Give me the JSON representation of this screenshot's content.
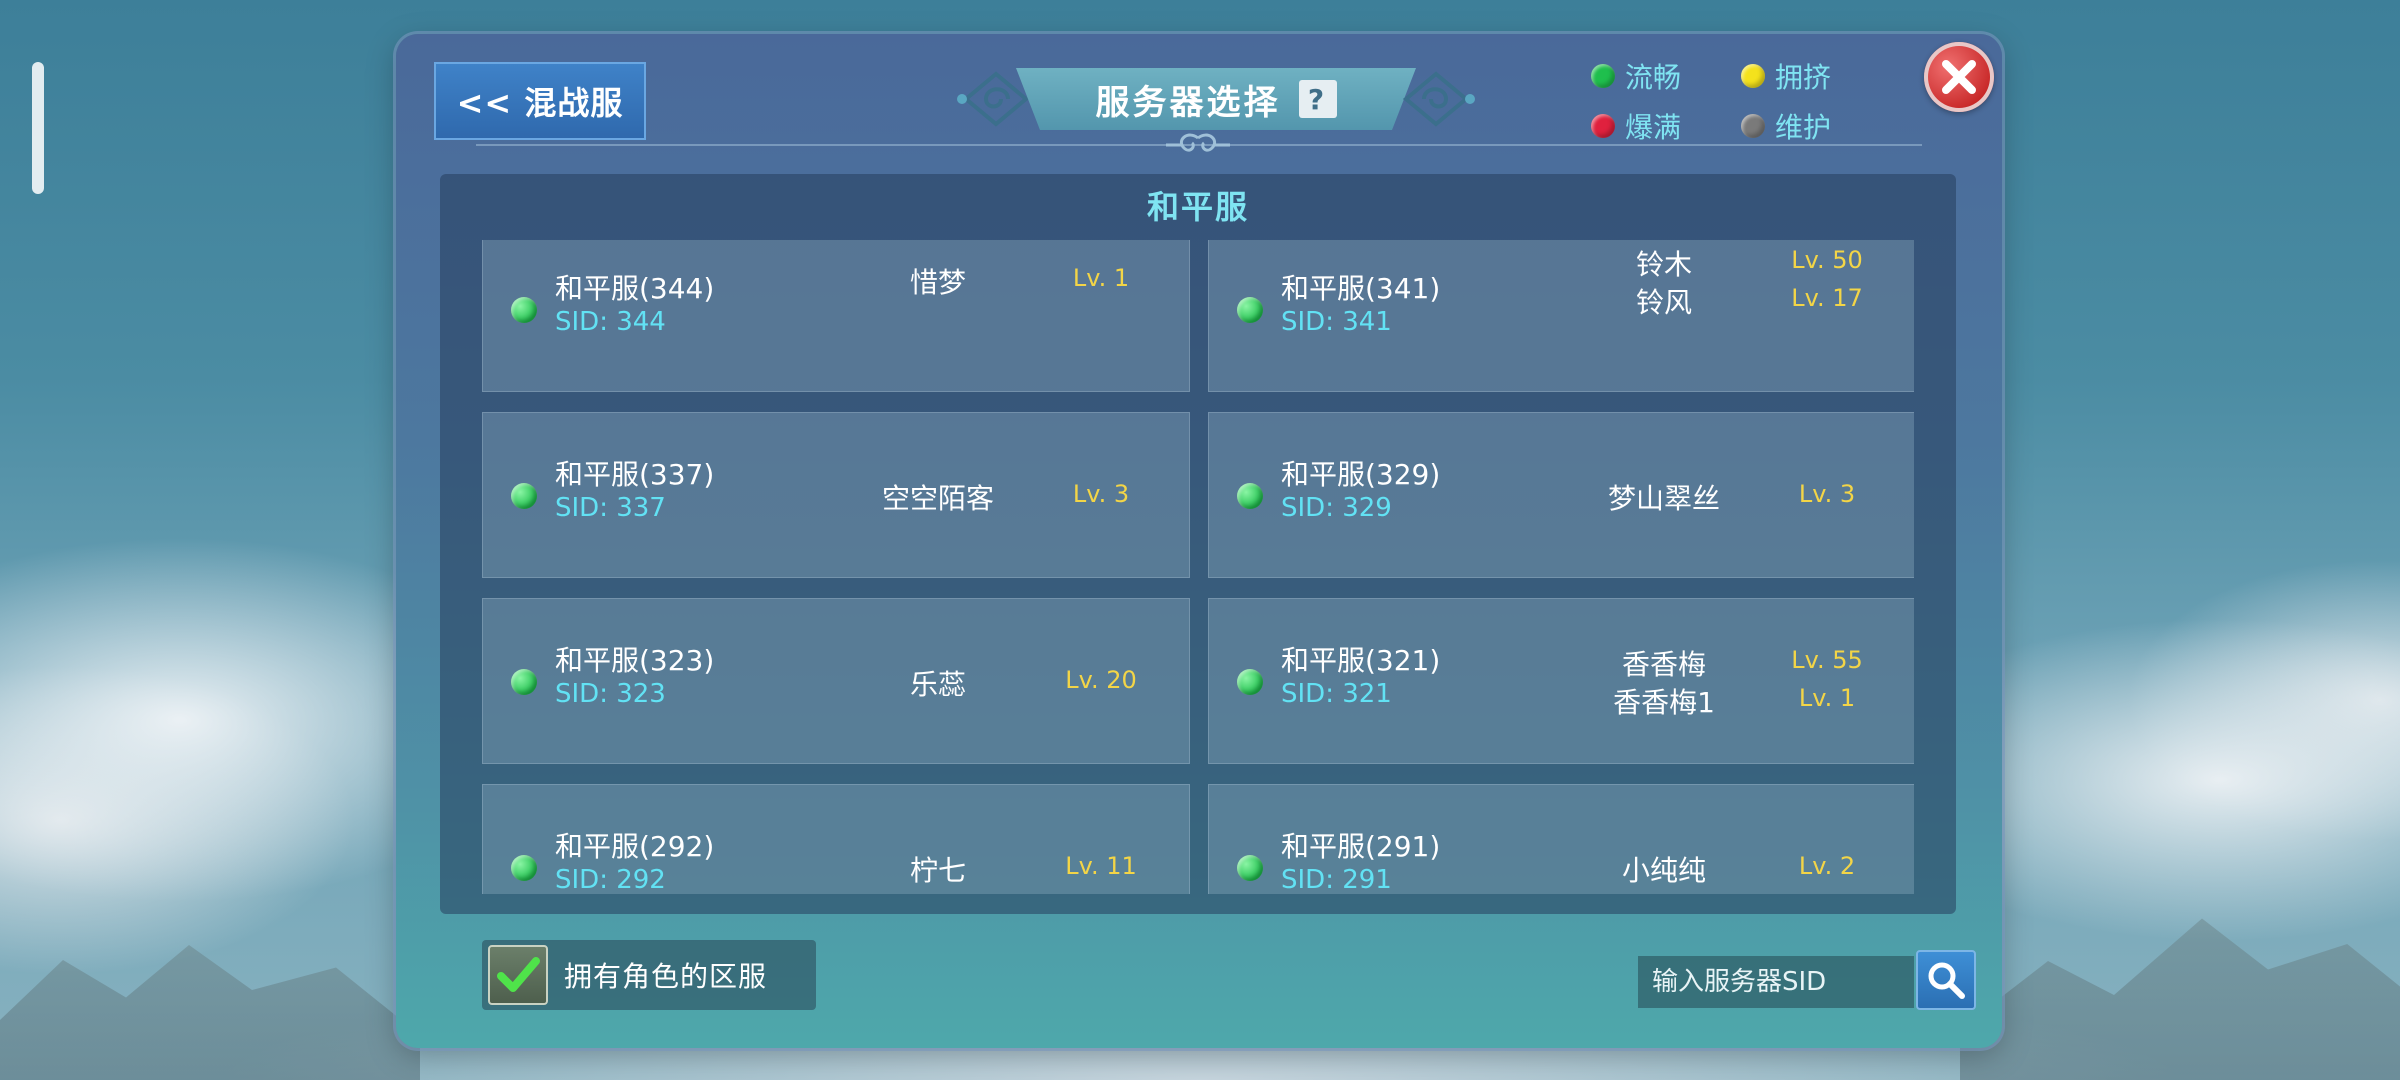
{
  "header": {
    "back_label": "<< 混战服",
    "title": "服务器选择",
    "help_label": "?"
  },
  "legend": [
    {
      "label": "流畅",
      "color": "#1fbf4d"
    },
    {
      "label": "拥挤",
      "color": "#f4e21c"
    },
    {
      "label": "爆满",
      "color": "#e0213e"
    },
    {
      "label": "维护",
      "color": "#7a7a7a"
    }
  ],
  "category": {
    "title": "和平服"
  },
  "servers": [
    {
      "name": "和平服(344)",
      "sid": "SID: 344",
      "status": "流畅",
      "characters": [
        {
          "name": "惜梦",
          "level": "Lv. 1"
        }
      ]
    },
    {
      "name": "和平服(341)",
      "sid": "SID: 341",
      "status": "流畅",
      "characters": [
        {
          "name": "铃木",
          "level": "Lv. 50"
        },
        {
          "name": "铃风",
          "level": "Lv. 17"
        }
      ]
    },
    {
      "name": "和平服(337)",
      "sid": "SID: 337",
      "status": "流畅",
      "characters": [
        {
          "name": "空空陌客",
          "level": "Lv. 3"
        }
      ]
    },
    {
      "name": "和平服(329)",
      "sid": "SID: 329",
      "status": "流畅",
      "characters": [
        {
          "name": "梦山翠丝",
          "level": "Lv. 3"
        }
      ]
    },
    {
      "name": "和平服(323)",
      "sid": "SID: 323",
      "status": "流畅",
      "characters": [
        {
          "name": "乐蕊",
          "level": "Lv. 20"
        }
      ]
    },
    {
      "name": "和平服(321)",
      "sid": "SID: 321",
      "status": "流畅",
      "characters": [
        {
          "name": "香香梅",
          "level": "Lv. 55"
        },
        {
          "name": "香香梅1",
          "level": "Lv. 1"
        }
      ]
    },
    {
      "name": "和平服(292)",
      "sid": "SID: 292",
      "status": "流畅",
      "characters": [
        {
          "name": "柠七",
          "level": "Lv. 11"
        }
      ]
    },
    {
      "name": "和平服(291)",
      "sid": "SID: 291",
      "status": "流畅",
      "characters": [
        {
          "name": "小纯纯",
          "level": "Lv. 2"
        }
      ]
    }
  ],
  "footer": {
    "owned_label": "拥有角色的区服",
    "owned_checked": true,
    "search_placeholder": "输入服务器SID"
  }
}
